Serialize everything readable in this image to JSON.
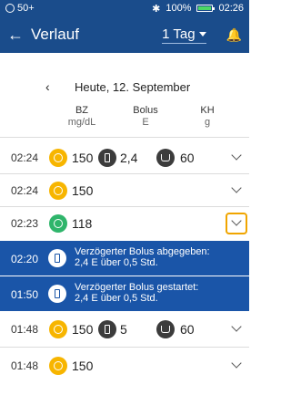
{
  "status": {
    "battery_left": "50+",
    "battery_pct": "100%",
    "time": "02:26"
  },
  "header": {
    "title": "Verlauf",
    "range": "1 Tag"
  },
  "date": {
    "label": "Heute, 12. September"
  },
  "columns": [
    {
      "name": "BZ",
      "unit": "mg/dL"
    },
    {
      "name": "Bolus",
      "unit": "E"
    },
    {
      "name": "KH",
      "unit": "g"
    }
  ],
  "rows": [
    {
      "time": "02:24",
      "bz": "150",
      "bolus": "2,4",
      "kh": "60"
    },
    {
      "time": "02:24",
      "bz": "150"
    },
    {
      "time": "02:23",
      "bz": "118"
    },
    {
      "time": "02:20",
      "line1": "Verzögerter Bolus abgegeben:",
      "line2": "2,4 E über 0,5 Std."
    },
    {
      "time": "01:50",
      "line1": "Verzögerter Bolus gestartet:",
      "line2": "2,4 E über 0,5 Std."
    },
    {
      "time": "01:48",
      "bz": "150",
      "bolus": "5",
      "kh": "60"
    },
    {
      "time": "01:48",
      "bz": "150"
    }
  ],
  "icons": {
    "bz": "glucose-icon",
    "bolus": "insulin-icon",
    "kh": "carb-icon"
  },
  "colors": {
    "header": "#1a4c8b",
    "highlight_row": "#1a55a8",
    "bz_normal": "#f7b500",
    "bz_in_range": "#2fb56b",
    "focus": "#f0a500"
  }
}
